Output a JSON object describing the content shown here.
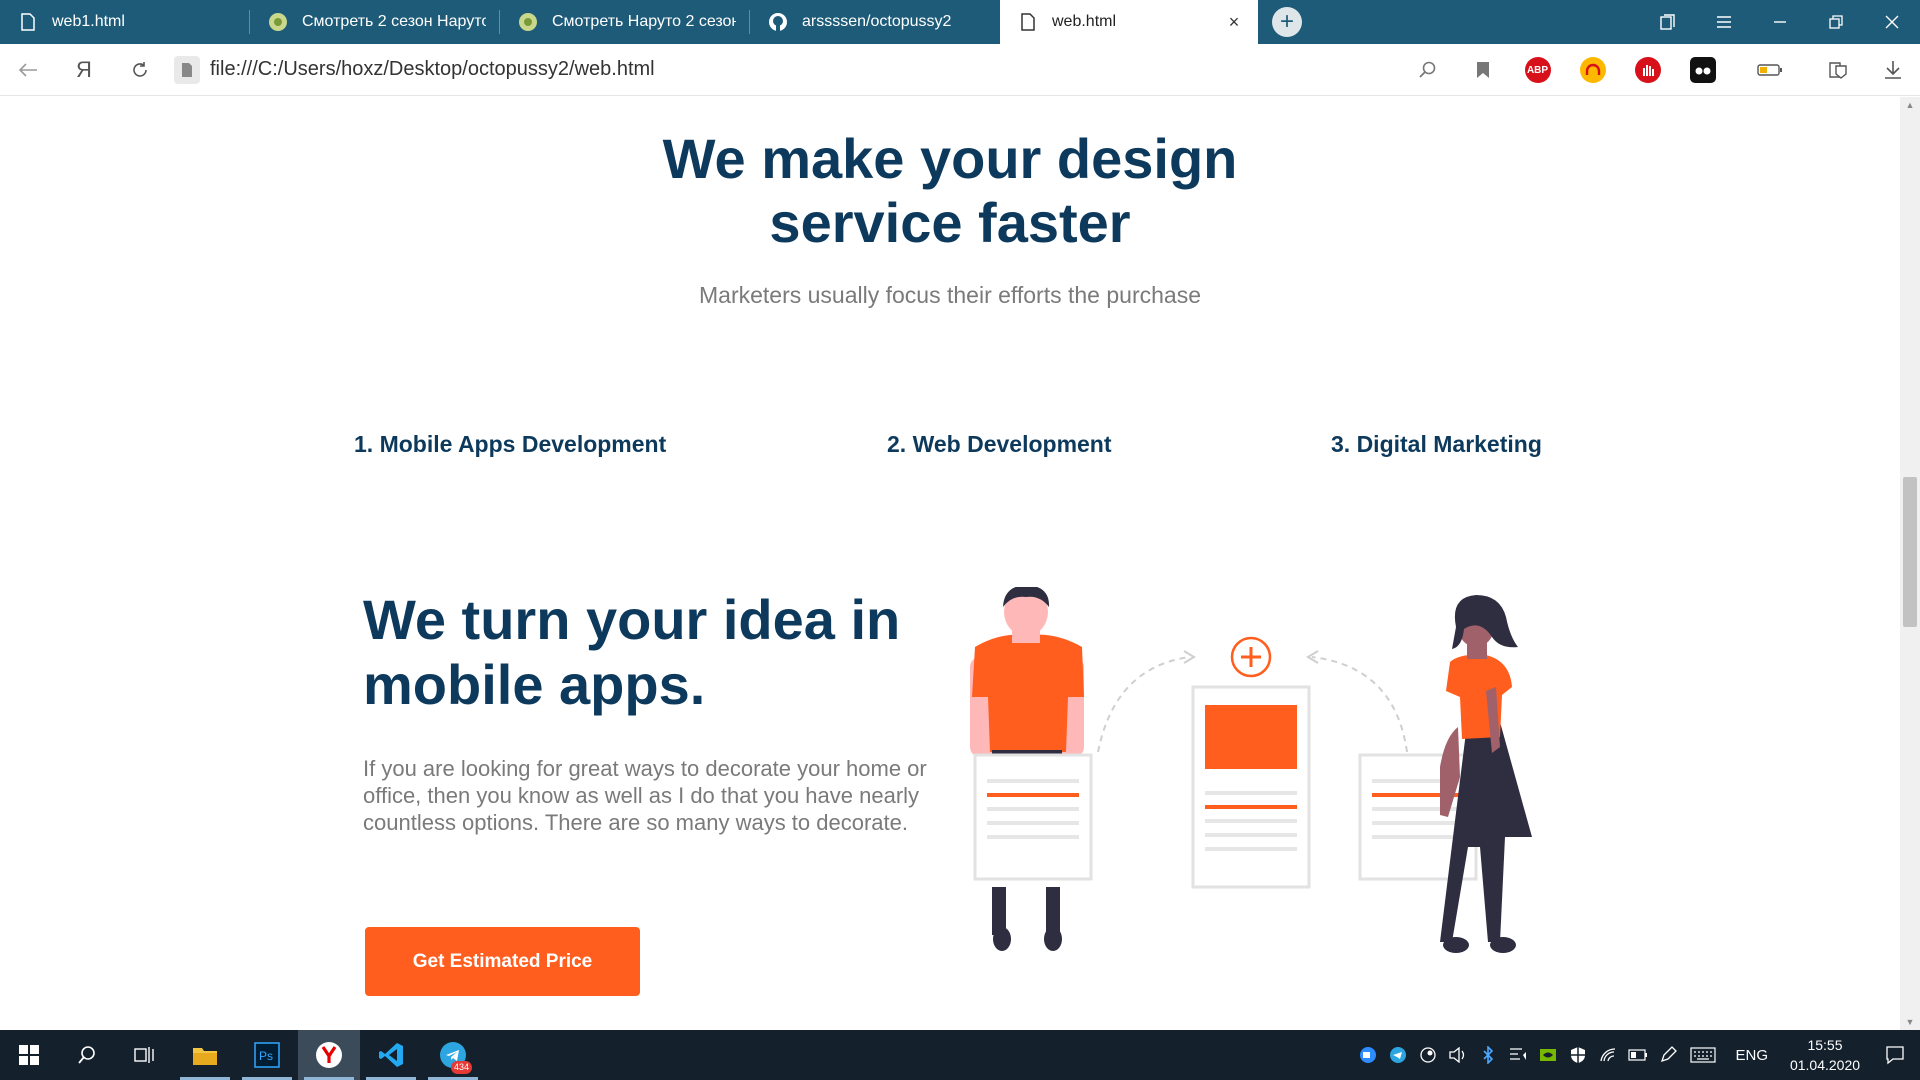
{
  "browser": {
    "tabs": [
      {
        "label": "web1.html",
        "active": false
      },
      {
        "label": "Смотреть 2 сезон Наруто",
        "active": false
      },
      {
        "label": "Смотреть Наруто 2 сезон",
        "active": false
      },
      {
        "label": "arssssen/octopussy2",
        "active": false
      },
      {
        "label": "web.html",
        "active": true
      }
    ],
    "close_glyph": "×",
    "new_tab_glyph": "+",
    "address": "file:///C:/Users/hoxz/Desktop/octopussy2/web.html",
    "yandex_glyph": "Я",
    "abp_label": "ABP",
    "accent": "#1d5b79"
  },
  "page": {
    "hero_title_line1": "We make your design",
    "hero_title_line2": "service faster",
    "hero_subtitle": "Marketers usually focus their efforts the purchase",
    "services": [
      "1. Mobile Apps Development",
      "2. Web Development",
      "3. Digital Marketing"
    ],
    "feature_title_line1": "We turn your idea in",
    "feature_title_line2": "mobile apps.",
    "feature_text": "If you are looking for great ways to decorate your home or office, then you know as well as I do that you have nearly countless options. There are so many ways to decorate.",
    "cta_label": "Get Estimated Price",
    "brand_color": "#0d3a5c",
    "accent_color": "#ff5e1f"
  },
  "taskbar": {
    "telegram_badge": "434",
    "language": "ENG",
    "time": "15:55",
    "date": "01.04.2020"
  }
}
